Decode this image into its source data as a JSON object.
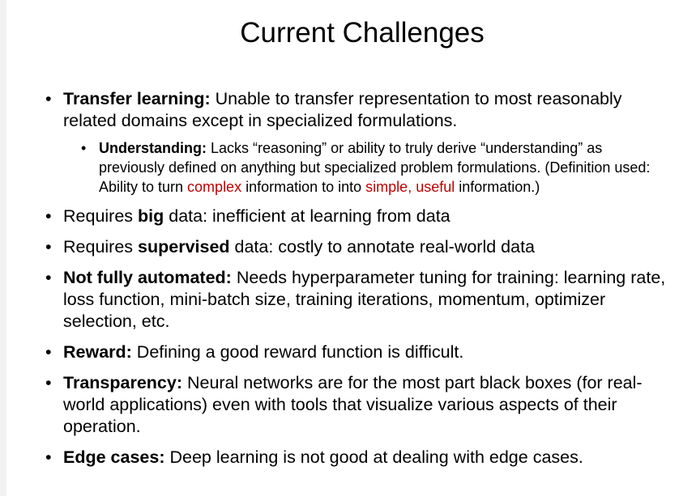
{
  "title": "Current Challenges",
  "bullets": {
    "transfer": {
      "term": "Transfer learning:",
      "text": " Unable to transfer representation to most reasonably related domains except in specialized formulations.",
      "sub": {
        "term": "Understanding:",
        "text_1": " Lacks “reasoning” or ability to truly derive “understanding” as previously defined on anything but specialized problem formulations. (Definition used: Ability to turn ",
        "hl_1": "complex",
        "text_2": " information to into ",
        "hl_2": "simple",
        "text_3": ", ",
        "hl_3": "useful",
        "text_4": " information.)"
      }
    },
    "big_data": {
      "pre": "Requires ",
      "bold": "big",
      "post": " data: inefficient at learning from data"
    },
    "supervised": {
      "pre": "Requires ",
      "bold": "supervised",
      "post": " data: costly to annotate real-world data"
    },
    "automated": {
      "term": "Not fully automated:",
      "text": " Needs hyperparameter tuning for training: learning rate, loss function, mini-batch size, training iterations, momentum, optimizer selection, etc."
    },
    "reward": {
      "term": "Reward:",
      "text": " Defining a good reward function is difficult."
    },
    "transparency": {
      "term": "Transparency:",
      "text": " Neural networks are for the most part black boxes (for real-world applications) even with tools that visualize various aspects of their operation."
    },
    "edge": {
      "term": "Edge cases:",
      "text": " Deep learning is not good at dealing with edge cases."
    }
  },
  "colors": {
    "highlight": "#c00000",
    "text": "#000000"
  }
}
